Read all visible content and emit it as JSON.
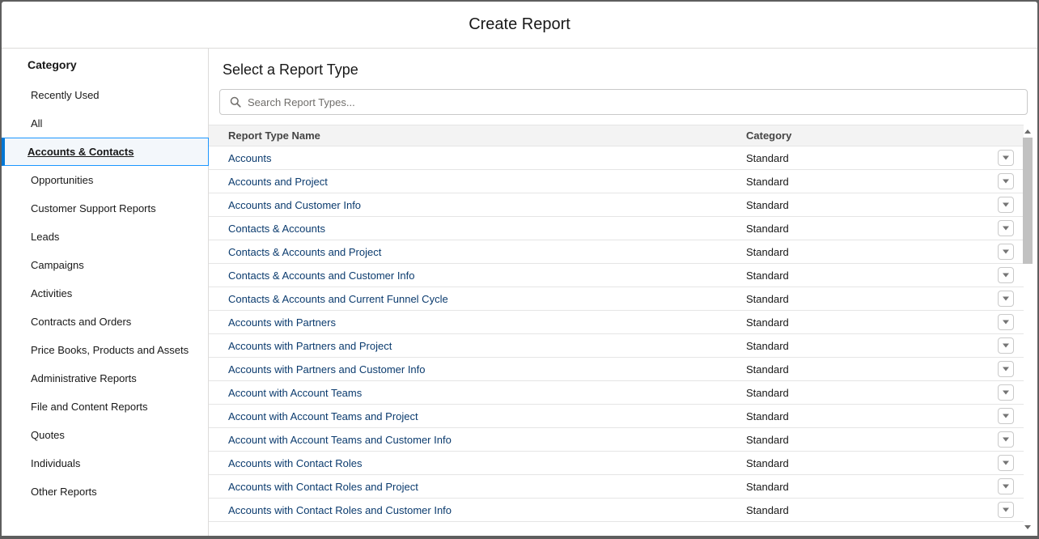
{
  "modal": {
    "title": "Create Report"
  },
  "sidebar": {
    "heading": "Category",
    "items": [
      {
        "label": "Recently Used"
      },
      {
        "label": "All"
      },
      {
        "label": "Accounts & Contacts",
        "active": true
      },
      {
        "label": "Opportunities"
      },
      {
        "label": "Customer Support Reports"
      },
      {
        "label": "Leads"
      },
      {
        "label": "Campaigns"
      },
      {
        "label": "Activities"
      },
      {
        "label": "Contracts and Orders"
      },
      {
        "label": "Price Books, Products and Assets"
      },
      {
        "label": "Administrative Reports"
      },
      {
        "label": "File and Content Reports"
      },
      {
        "label": "Quotes"
      },
      {
        "label": "Individuals"
      },
      {
        "label": "Other Reports"
      }
    ]
  },
  "main": {
    "heading": "Select a Report Type",
    "search": {
      "placeholder": "Search Report Types...",
      "value": "",
      "icon": "search-icon"
    },
    "table": {
      "columns": [
        "Report Type Name",
        "Category"
      ],
      "rows": [
        {
          "name": "Accounts",
          "category": "Standard"
        },
        {
          "name": "Accounts and Project",
          "category": "Standard"
        },
        {
          "name": "Accounts and Customer Info",
          "category": "Standard"
        },
        {
          "name": "Contacts & Accounts",
          "category": "Standard"
        },
        {
          "name": "Contacts & Accounts and Project",
          "category": "Standard"
        },
        {
          "name": "Contacts & Accounts and Customer Info",
          "category": "Standard"
        },
        {
          "name": "Contacts & Accounts and Current Funnel Cycle",
          "category": "Standard"
        },
        {
          "name": "Accounts with Partners",
          "category": "Standard"
        },
        {
          "name": "Accounts with Partners and Project",
          "category": "Standard"
        },
        {
          "name": "Accounts with Partners and Customer Info",
          "category": "Standard"
        },
        {
          "name": "Account with Account Teams",
          "category": "Standard"
        },
        {
          "name": "Account with Account Teams and Project",
          "category": "Standard"
        },
        {
          "name": "Account with Account Teams and Customer Info",
          "category": "Standard"
        },
        {
          "name": "Accounts with Contact Roles",
          "category": "Standard"
        },
        {
          "name": "Accounts with Contact Roles and Project",
          "category": "Standard"
        },
        {
          "name": "Accounts with Contact Roles and Customer Info",
          "category": "Standard"
        }
      ]
    }
  },
  "colors": {
    "accent": "#0176d3",
    "active_bg": "#f3f7fb",
    "border": "#dddbda"
  }
}
